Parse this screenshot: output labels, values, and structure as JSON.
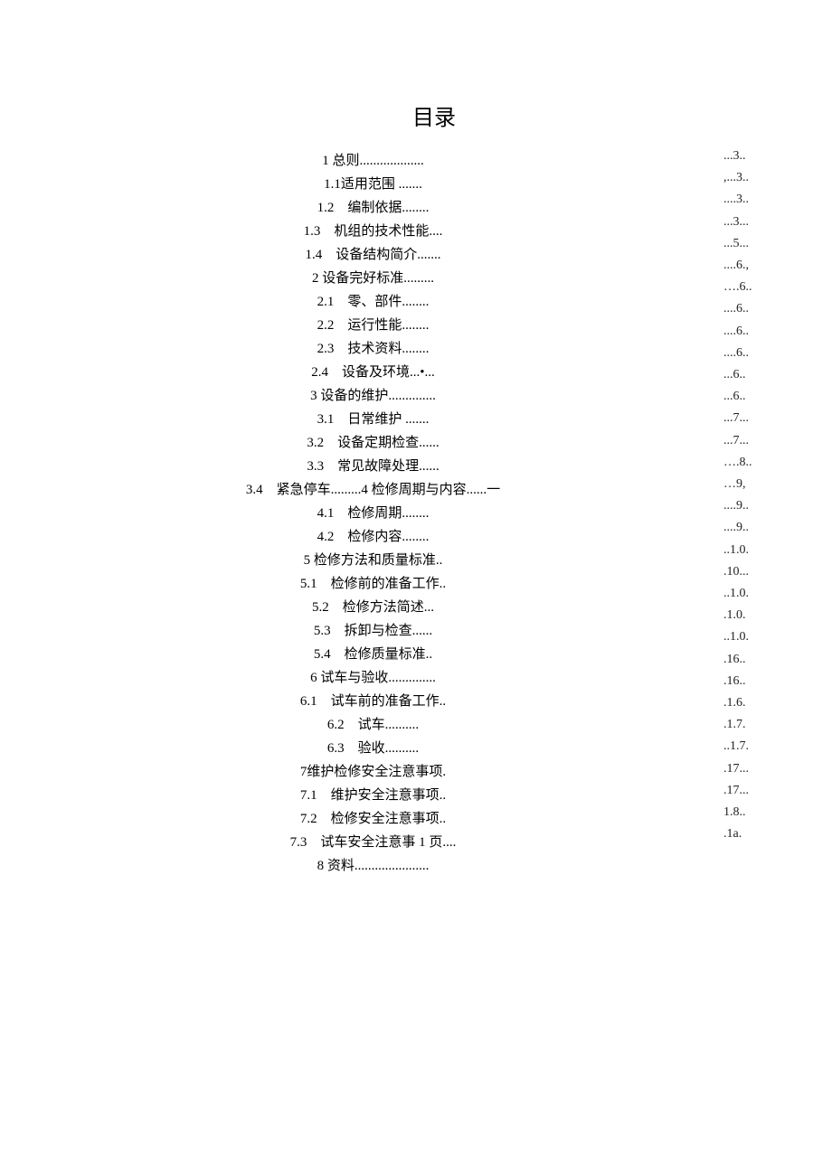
{
  "title": "目录",
  "entries": [
    {
      "text": "1 总则...................",
      "page": "...3.."
    },
    {
      "text": "1.1适用范围 .......",
      "page": ",...3.."
    },
    {
      "text": "1.2　编制依据........",
      "page": "....3.."
    },
    {
      "text": "1.3　机组的技术性能....",
      "page": "...3..."
    },
    {
      "text": "1.4　设备结构简介.......",
      "page": "...5..."
    },
    {
      "text": "2 设备完好标准.........",
      "page": "....6.,"
    },
    {
      "text": "2.1　零、部件........",
      "page": "….6.."
    },
    {
      "text": "2.2　运行性能........",
      "page": "....6.."
    },
    {
      "text": "2.3　技术资料........",
      "page": "....6.."
    },
    {
      "text": "2.4　设备及环境...•...",
      "page": "....6.."
    },
    {
      "text": "3 设备的维护..............",
      "page": "...6.."
    },
    {
      "text": "3.1　日常维护 .......",
      "page": "...6.."
    },
    {
      "text": "3.2　设备定期检查......",
      "page": "...7..."
    },
    {
      "text": "3.3　常见故障处理......",
      "page": "...7..."
    },
    {
      "text": "3.4　紧急停车.........4 检修周期与内容......一",
      "page": "….8.."
    },
    {
      "text": "4.1　检修周期........",
      "page": "…9,"
    },
    {
      "text": "4.2　检修内容........",
      "page": "....9.."
    },
    {
      "text": "5 检修方法和质量标准..",
      "page": "....9.."
    },
    {
      "text": "5.1　检修前的准备工作..",
      "page": "..1.0."
    },
    {
      "text": "5.2　检修方法简述...",
      "page": ".10..."
    },
    {
      "text": "5.3　拆卸与检查......",
      "page": "..1.0."
    },
    {
      "text": "5.4　检修质量标准..",
      "page": ".1.0."
    },
    {
      "text": "6 试车与验收..............",
      "page": "..1.0."
    },
    {
      "text": "6.1　试车前的准备工作..",
      "page": ".16.."
    },
    {
      "text": "6.2　试车..........",
      "page": ".16.."
    },
    {
      "text": "6.3　验收..........",
      "page": ".1.6."
    },
    {
      "text": "7维护检修安全注意事项.",
      "page": ".1.7."
    },
    {
      "text": "7.1　维护安全注意事项..",
      "page": "..1.7."
    },
    {
      "text": "7.2　检修安全注意事项..",
      "page": ".17..."
    },
    {
      "text": "7.3　试车安全注意事 1 页....",
      "page": ".17..."
    },
    {
      "text": "8 资料......................",
      "page": "1.8.."
    },
    {
      "text": "",
      "page": ".1a."
    }
  ]
}
